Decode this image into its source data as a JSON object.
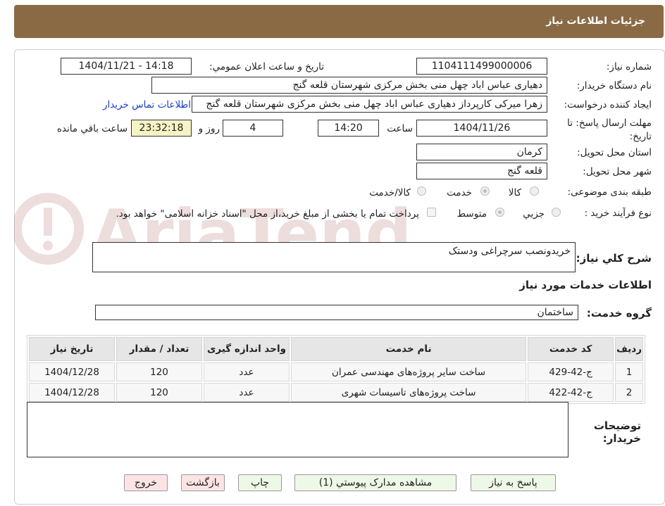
{
  "header": {
    "title": "جزئیات اطلاعات نیاز"
  },
  "labels": {
    "need_number": "شماره نیاز:",
    "announce_datetime": "تاریخ و ساعت اعلان عمومي:",
    "buyer_org": "نام دستگاه خريدار:",
    "requester": "ايجاد کننده درخواست:",
    "deadline_line1": "مهلت ارسال پاسخ: تا",
    "deadline_line2": "تاريخ:",
    "time_word": "ساعت",
    "days_word": "روز و",
    "remaining_word": "ساعت باقي مانده",
    "province": "استان محل تحويل:",
    "city": "شهر محل تحويل:",
    "category": "طبقه بندی موضوعی:",
    "purchase_type": "نوع فرآيند خريد :",
    "need_summary": "شرح کلي نياز:",
    "services_section": "اطلاعات خدمات مورد نياز",
    "service_group": "گروه خدمت:",
    "buyer_notes_line1": "توضيحات",
    "buyer_notes_line2": "خريدار:"
  },
  "values": {
    "need_number": "1104111499000006",
    "announce_datetime": "1404/11/21 - 14:18",
    "buyer_org": "دهیاری عباس اباد چهل منی بخش مرکزی شهرستان قلعه گنج",
    "requester": "زهرا میرکی کارپرداز دهیاری عباس اباد چهل منی بخش مرکزی شهرستان قلعه گنج",
    "buyer_contact_link": "اطلاعات تماس خريدار",
    "deadline_date": "1404/11/26",
    "deadline_time": "14:20",
    "days": "4",
    "remaining": "23:32:18",
    "province": "کرمان",
    "city": "قلعه گنج",
    "need_summary": "خریدونصب سرچراغی ودستک",
    "service_group": "ساختمان",
    "buyer_notes": ""
  },
  "category_options": [
    {
      "label": "کالا",
      "selected": false
    },
    {
      "label": "خدمت",
      "selected": true
    },
    {
      "label": "کالا/خدمت",
      "selected": false
    }
  ],
  "purchase_options": [
    {
      "label": "جزيي",
      "selected": false
    },
    {
      "label": "متوسط",
      "selected": true
    }
  ],
  "payment_note": "پرداخت تمام يا بخشی از مبلغ خريد،از محل \"اسناد خزانه اسلامی\" خواهد بود.",
  "table": {
    "headers": [
      "رديف",
      "کد خدمت",
      "نام خدمت",
      "واحد اندازه گيری",
      "تعداد / مقدار",
      "تاريخ نياز"
    ],
    "rows": [
      [
        "1",
        "ج-42-429",
        "ساخت سایر پروژه‌های مهندسی عمران",
        "عدد",
        "120",
        "1404/12/28"
      ],
      [
        "2",
        "ج-42-422",
        "ساخت پروژه‌های تاسیسات شهری",
        "عدد",
        "120",
        "1404/12/28"
      ]
    ]
  },
  "buttons": {
    "reply": "پاسخ به نياز",
    "attachments": "مشاهده مدارک پيوستي (1)",
    "print": "چاپ",
    "back": "بازگشت",
    "exit": "خروج"
  },
  "watermark": "AriaTender.neT",
  "colors": {
    "header_bg": "#8a6a44",
    "link": "#1a3fbf",
    "remaining_bg": "#f6f3c4",
    "reply_btn": "#eef8e6",
    "exit_btn": "#fde4e4"
  }
}
